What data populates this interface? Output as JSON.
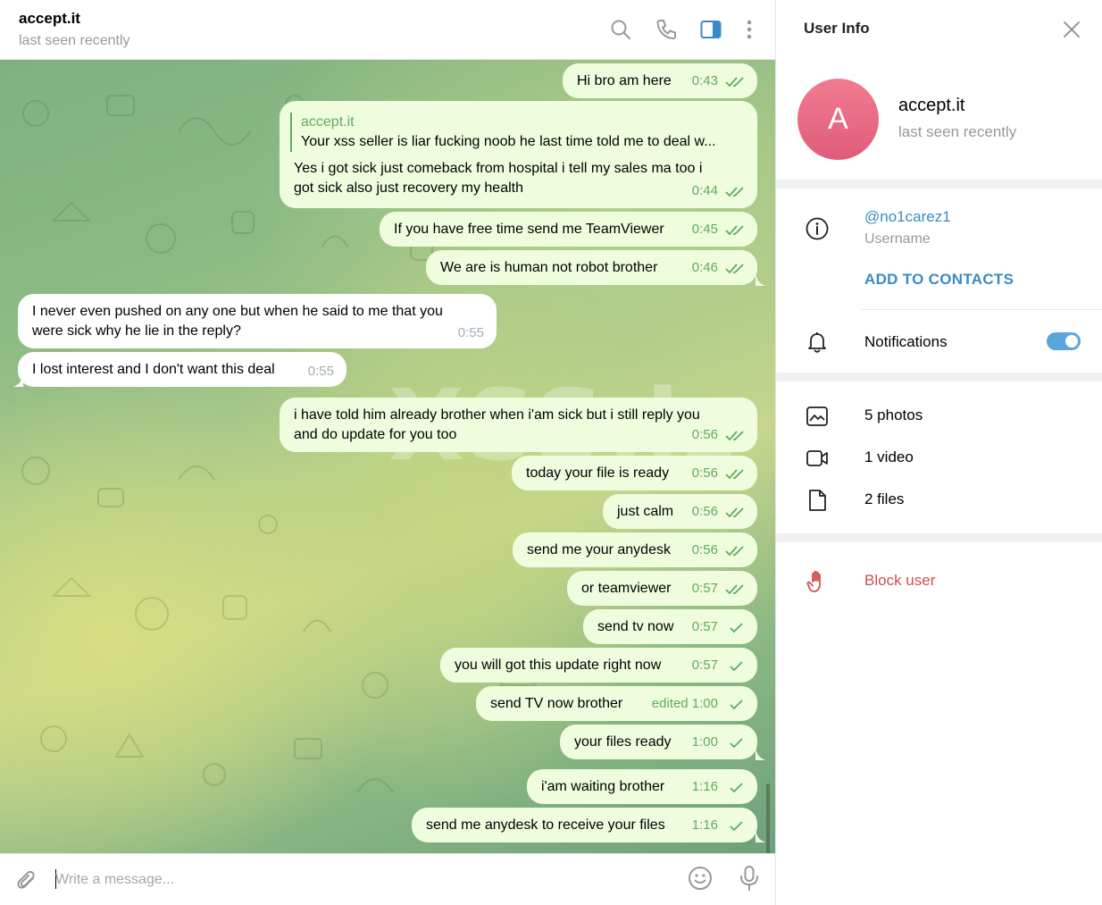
{
  "chat": {
    "title": "accept.it",
    "status": "last seen recently",
    "input_placeholder": "Write a message...",
    "watermark": "XSS.is",
    "messages": [
      {
        "text": "Hi bro am here",
        "time": "0:43"
      },
      {
        "reply_name": "accept.it",
        "reply_text": "Your xss seller is liar fucking noob he last time told me to deal w...",
        "text_1": "Yes i got sick just comeback from hospital i tell my sales ma too i",
        "text_2": "got sick also just recovery my health",
        "time": "0:44"
      },
      {
        "text": "If you have free time send me TeamViewer",
        "time": "0:45"
      },
      {
        "text": "We are is human not robot brother",
        "time": "0:46"
      },
      {
        "text_1": "I never even pushed on any one but when he said to me that you",
        "text_2": "were sick why he lie in the reply?",
        "time": "0:55"
      },
      {
        "text": "I lost interest and I don't want this deal",
        "time": "0:55"
      },
      {
        "text_1": "i have told him already brother when i'am sick but i still reply you",
        "text_2": "and do update for you too",
        "time": "0:56"
      },
      {
        "text": "today your file is ready",
        "time": "0:56"
      },
      {
        "text": "just calm",
        "time": "0:56"
      },
      {
        "text": "send me your anydesk",
        "time": "0:56"
      },
      {
        "text": "or teamviewer",
        "time": "0:57"
      },
      {
        "text": "send tv now",
        "time": "0:57"
      },
      {
        "text": "you will got this update right now",
        "time": "0:57"
      },
      {
        "text": "send TV now brother",
        "time": "edited 1:00"
      },
      {
        "text": "your files ready",
        "time": "1:00"
      },
      {
        "text": "i'am waiting brother",
        "time": "1:16"
      },
      {
        "text": "send me anydesk to receive your files",
        "time": "1:16"
      }
    ]
  },
  "info": {
    "title": "User Info",
    "avatar_letter": "A",
    "name": "accept.it",
    "status": "last seen recently",
    "username": "@no1carez1",
    "username_label": "Username",
    "add_contacts": "ADD TO CONTACTS",
    "notifications": "Notifications",
    "notifications_on": true,
    "photos": "5 photos",
    "video": "1 video",
    "files": "2 files",
    "block": "Block user"
  },
  "colors": {
    "accent": "#3a8bc5",
    "outgoing_bubble": "#effdde",
    "outgoing_time": "#5fab61",
    "danger": "#d14e4e",
    "avatar": "#e8677f"
  },
  "icons": [
    "search-icon",
    "phone-icon",
    "sidebar-toggle-icon",
    "more-vertical-icon",
    "close-icon",
    "info-icon",
    "bell-icon",
    "photo-icon",
    "video-icon",
    "file-icon",
    "hand-stop-icon",
    "paperclip-icon",
    "emoji-icon",
    "microphone-icon",
    "double-check-icon",
    "single-check-icon"
  ]
}
